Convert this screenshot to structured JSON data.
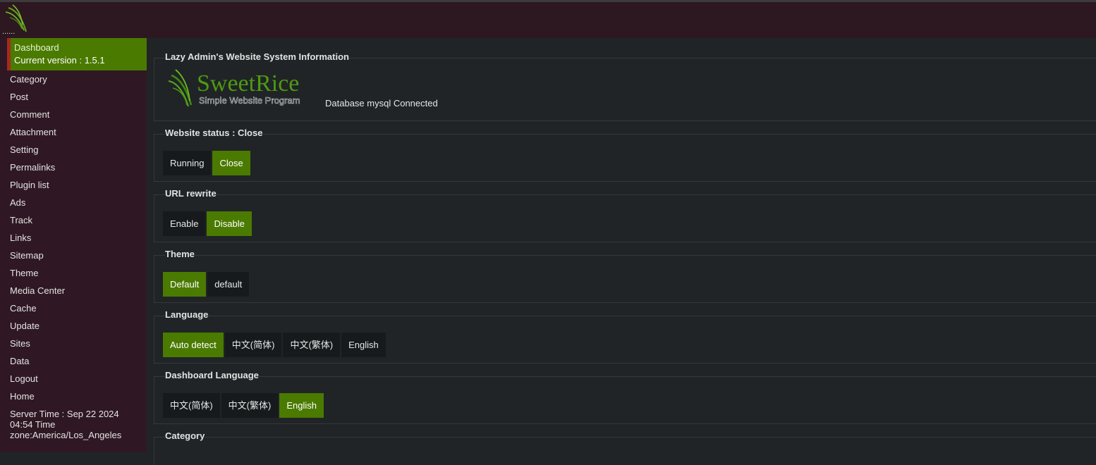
{
  "header": {
    "dots": "......"
  },
  "sidebar": {
    "active_label": "Dashboard",
    "version": "Current version : 1.5.1",
    "items": [
      {
        "label": "Category"
      },
      {
        "label": "Post"
      },
      {
        "label": "Comment"
      },
      {
        "label": "Attachment"
      },
      {
        "label": "Setting"
      },
      {
        "label": "Permalinks"
      },
      {
        "label": "Plugin list"
      },
      {
        "label": "Ads"
      },
      {
        "label": "Track"
      },
      {
        "label": "Links"
      },
      {
        "label": "Sitemap"
      },
      {
        "label": "Theme"
      },
      {
        "label": "Media Center"
      },
      {
        "label": "Cache"
      },
      {
        "label": "Update"
      },
      {
        "label": "Sites"
      },
      {
        "label": "Data"
      },
      {
        "label": "Logout"
      },
      {
        "label": "Home"
      }
    ],
    "server_time": "Server Time : Sep 22 2024 04:54 Time zone:America/Los_Angeles"
  },
  "system_info": {
    "heading": "Lazy Admin's Website System Information",
    "logo_title": "SweetRice",
    "logo_subtitle": "Simple Website Program",
    "db_status": "Database mysql Connected"
  },
  "website_status": {
    "heading": "Website status : Close",
    "options": [
      "Running",
      "Close"
    ],
    "selected": "Close"
  },
  "url_rewrite": {
    "heading": "URL rewrite",
    "options": [
      "Enable",
      "Disable"
    ],
    "selected": "Disable"
  },
  "theme": {
    "heading": "Theme",
    "options": [
      "Default",
      "default"
    ],
    "selected": "Default"
  },
  "language": {
    "heading": "Language",
    "options": [
      "Auto detect",
      "中文(简体)",
      "中文(繁体)",
      "English"
    ],
    "selected": "Auto detect"
  },
  "dashboard_language": {
    "heading": "Dashboard Language",
    "options": [
      "中文(简体)",
      "中文(繁体)",
      "English"
    ],
    "selected": "English"
  },
  "category": {
    "heading": "Category"
  },
  "colors": {
    "accent_green": "#4a7a00",
    "sidebar_bg": "#2f1823",
    "main_bg": "#202426",
    "active_marker": "#a52a1e"
  }
}
